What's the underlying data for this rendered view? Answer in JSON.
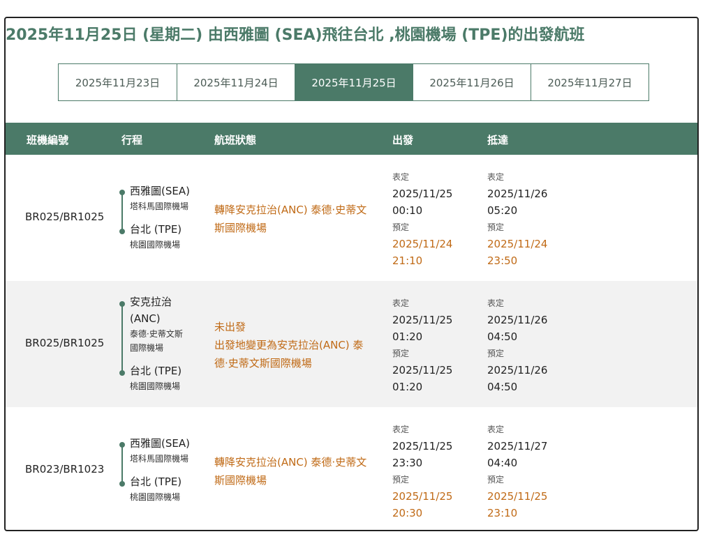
{
  "page_title": "2025年11月25日 (星期二) 由西雅圖 (SEA)飛往台北 ,桃園機場 (TPE)的出發航班",
  "date_tabs": [
    {
      "label": "2025年11月23日",
      "active": false
    },
    {
      "label": "2025年11月24日",
      "active": false
    },
    {
      "label": "2025年11月25日",
      "active": true
    },
    {
      "label": "2025年11月26日",
      "active": false
    },
    {
      "label": "2025年11月27日",
      "active": false
    }
  ],
  "columns": {
    "flight_no": "班機編號",
    "route": "行程",
    "status": "航班狀態",
    "depart": "出發",
    "arrive": "抵達"
  },
  "labels": {
    "scheduled": "表定",
    "estimated": "預定"
  },
  "colors": {
    "primary": "#4b7a68",
    "warning": "#c06a16",
    "row_alt": "#f2f2f2"
  },
  "flights": [
    {
      "flight_no": "BR025/BR1025",
      "origin_city": "西雅圖(SEA)",
      "origin_airport": "塔科馬國際機場",
      "dest_city": "台北 (TPE)",
      "dest_airport": "桃園國際機場",
      "status_lines": [
        "轉降安克拉治(ANC) 泰德·史蒂文",
        "斯國際機場"
      ],
      "depart": {
        "scheduled_date": "2025/11/25",
        "scheduled_time": "00:10",
        "estimated_date": "2025/11/24",
        "estimated_time": "21:10"
      },
      "arrive": {
        "scheduled_date": "2025/11/26",
        "scheduled_time": "05:20",
        "estimated_date": "2025/11/24",
        "estimated_time": "23:50"
      }
    },
    {
      "flight_no": "BR025/BR1025",
      "origin_city_lines": [
        "安克拉治",
        "(ANC)"
      ],
      "origin_airport_lines": [
        "泰德·史蒂文斯",
        "國際機場"
      ],
      "dest_city": "台北 (TPE)",
      "dest_airport": "桃園國際機場",
      "status_lines": [
        "未出發",
        "出發地變更為安克拉治(ANC) 泰",
        "德·史蒂文斯國際機場"
      ],
      "depart": {
        "scheduled_date": "2025/11/25",
        "scheduled_time": "01:20",
        "estimated_date": "2025/11/25",
        "estimated_time": "01:20"
      },
      "arrive": {
        "scheduled_date": "2025/11/26",
        "scheduled_time": "04:50",
        "estimated_date": "2025/11/26",
        "estimated_time": "04:50"
      }
    },
    {
      "flight_no": "BR023/BR1023",
      "origin_city": "西雅圖(SEA)",
      "origin_airport": "塔科馬國際機場",
      "dest_city": "台北 (TPE)",
      "dest_airport": "桃園國際機場",
      "status_lines": [
        "轉降安克拉治(ANC) 泰德·史蒂文",
        "斯國際機場"
      ],
      "depart": {
        "scheduled_date": "2025/11/25",
        "scheduled_time": "23:30",
        "estimated_date": "2025/11/25",
        "estimated_time": "20:30"
      },
      "arrive": {
        "scheduled_date": "2025/11/27",
        "scheduled_time": "04:40",
        "estimated_date": "2025/11/25",
        "estimated_time": "23:10"
      }
    }
  ]
}
